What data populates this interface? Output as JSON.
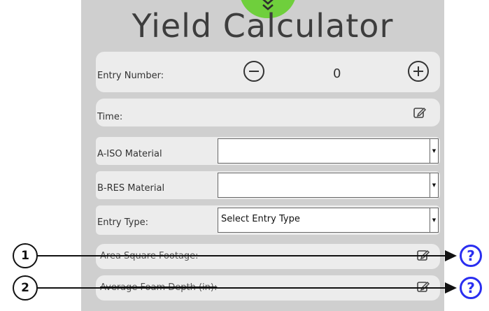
{
  "title": "Yield Calculator",
  "entry_number": {
    "label": "Entry Number:",
    "value": "0"
  },
  "time": {
    "label": "Time:"
  },
  "a_iso": {
    "label": "A-ISO Material",
    "value": ""
  },
  "b_res": {
    "label": "B-RES Material",
    "value": ""
  },
  "entry_type": {
    "label": "Entry Type:",
    "value": "Select Entry Type"
  },
  "area": {
    "label": "Area Square Footage:"
  },
  "foam_depth": {
    "label": "Average Foam Depth (in):"
  },
  "callouts": {
    "one": "1",
    "two": "2",
    "help_glyph": "?"
  },
  "colors": {
    "accent": "#6fcf3c",
    "help": "#2a2ef0"
  },
  "icons": [
    "chevron-down-double-icon",
    "minus-circle-icon",
    "plus-circle-icon",
    "edit-icon",
    "help-icon"
  ]
}
